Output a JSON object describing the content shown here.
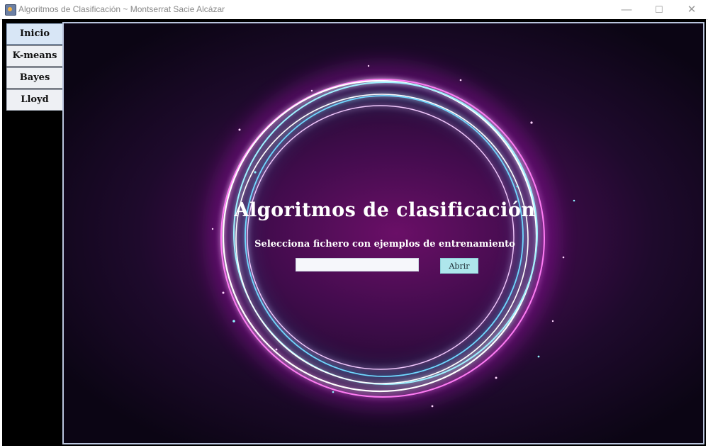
{
  "window": {
    "title": "Algoritmos de Clasificación ~ Montserrat Sacie Alcázar",
    "minimize_glyph": "—",
    "maximize_glyph": "☐",
    "close_glyph": "✕"
  },
  "tabs": [
    {
      "label": "Inicio",
      "active": true
    },
    {
      "label": "K-means",
      "active": false
    },
    {
      "label": "Bayes",
      "active": false
    },
    {
      "label": "Lloyd",
      "active": false
    }
  ],
  "main": {
    "title": "Algoritmos de clasificación",
    "subtitle": "Selecciona fichero con ejemplos de entrenamiento",
    "file_input_value": "",
    "open_button_label": "Abrir"
  },
  "colors": {
    "panel_border": "#b9c4dd",
    "ring_glow_cyan": "#7fe9ff",
    "ring_glow_magenta": "#ff3df0",
    "button_bg": "#aee6ec"
  }
}
